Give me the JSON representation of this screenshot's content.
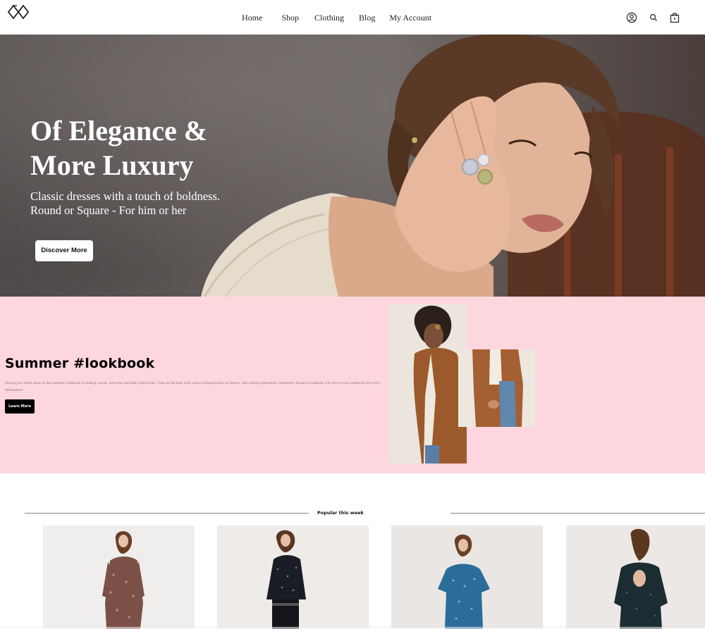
{
  "header": {
    "nav": [
      "Home",
      "Shop",
      "Clothing",
      "Blog",
      "My Account"
    ],
    "icons": [
      "logo-icon",
      "account-icon",
      "search-icon",
      "bag-icon"
    ]
  },
  "hero": {
    "title_line1": "Of Elegance &",
    "title_line2": "More Luxury",
    "subtitle_line1": "Classic dresses with a touch of boldness.",
    "subtitle_line2": "Round or Square - For him or her",
    "button": "Discover More"
  },
  "lookbook": {
    "title": "Summer #lookbook",
    "text": "Sharing ten outfit ideas in this summer lookbook including casual, everyday and date night looks. Turn up the heat with colour-infused prints on breezy, skin-baring silhouettes. Summerly Escape Lookbook will revive your wardrobe for every destination!",
    "button": "Learn More",
    "background": "#fed6de"
  },
  "popular": {
    "title": "Popular this week"
  }
}
